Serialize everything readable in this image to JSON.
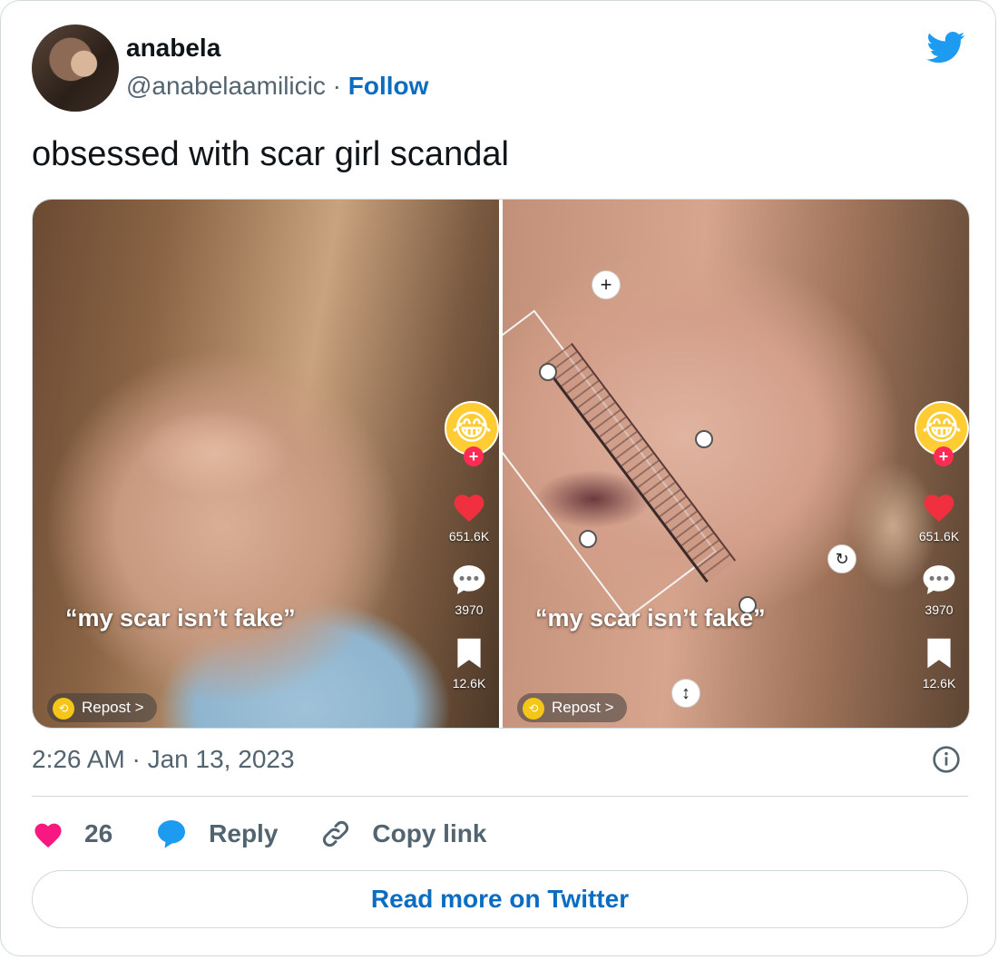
{
  "author": {
    "name": "anabela",
    "handle": "@anabelaamilicic",
    "separator": "·",
    "follow_label": "Follow"
  },
  "tweet": {
    "text": "obsessed with scar girl scandal",
    "timestamp": "2:26 AM · Jan 13, 2023"
  },
  "media": {
    "left_panel": {
      "caption": "“my scar isn’t fake”",
      "likes": "651.6K",
      "comments": "3970",
      "saves": "12.6K",
      "repost_label": "Repost",
      "repost_chevron": ">"
    },
    "right_panel": {
      "caption": "“my scar isn’t fake”",
      "likes": "651.6K",
      "comments": "3970",
      "saves": "12.6K",
      "repost_label": "Repost",
      "repost_chevron": ">"
    }
  },
  "actions": {
    "like_count": "26",
    "reply_label": "Reply",
    "copy_link_label": "Copy link"
  },
  "read_more_label": "Read more on Twitter",
  "colors": {
    "link": "#0a6dc2",
    "heart": "#f91880",
    "twitter_blue": "#1d9bf0",
    "muted": "#536471"
  }
}
